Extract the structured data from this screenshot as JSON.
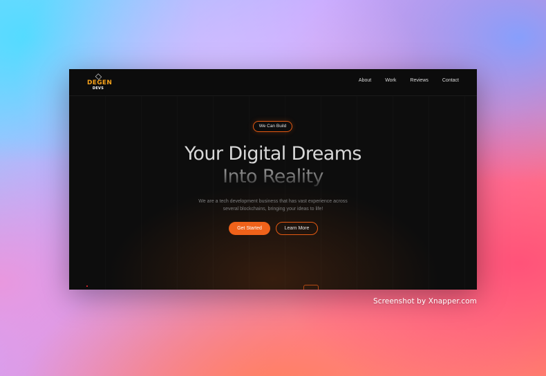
{
  "brand": {
    "logo_top": "DEGEN",
    "logo_bottom": "DEVS",
    "accent_color": "#f0621a",
    "logo_color": "#f7a21b"
  },
  "nav": {
    "items": [
      {
        "label": "About"
      },
      {
        "label": "Work"
      },
      {
        "label": "Reviews"
      },
      {
        "label": "Contact"
      }
    ]
  },
  "hero": {
    "pill": "We Can Build",
    "title_line1": "Your Digital Dreams",
    "title_line2": "Into Reality",
    "subtitle_line1": "We are a tech development business that has vast experience across",
    "subtitle_line2": "several blockchains, bringing your ideas to life!",
    "primary_button": "Get Started",
    "secondary_button": "Learn More"
  },
  "watermark": "Screenshot by Xnapper.com"
}
